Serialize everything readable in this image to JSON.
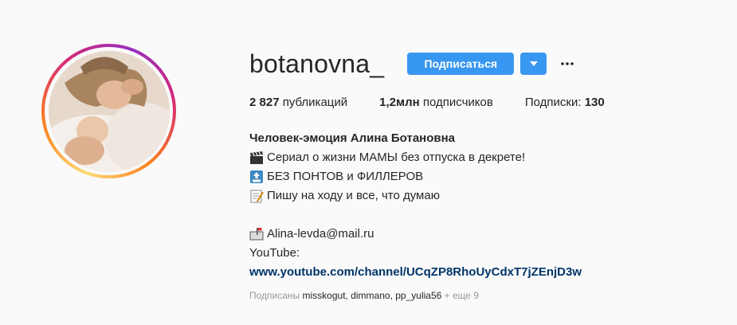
{
  "profile": {
    "username": "botanovna_",
    "follow_label": "Подписаться",
    "posts_count": "2 827",
    "posts_label": "публикаций",
    "followers_count": "1,2млн",
    "followers_label": "подписчиков",
    "following_label": "Подписки:",
    "following_count": "130"
  },
  "bio": {
    "name": "Человек-эмоция Алина Ботановна",
    "line1": "Сериал о жизни МАМЫ без отпуска в декрете!",
    "line2": "БЕЗ ПОНТОВ и ФИЛЛЕРОВ",
    "line3": "Пишу на ходу и все, что думаю",
    "email": "Alina-levda@mail.ru",
    "youtube_label": "YouTube:",
    "link": "www.youtube.com/channel/UCqZP8RhoUyCdxT7jZEnjD3w"
  },
  "followed_by": {
    "prefix": "Подписаны",
    "user1": "misskogut,",
    "user2": "dimmano,",
    "user3": "pp_yulia56",
    "suffix": "+ еще 9"
  },
  "icons": {
    "emoji1": "clapper-board-icon",
    "emoji2": "top-arrow-icon",
    "emoji3": "memo-icon",
    "emoji4": "mailbox-icon"
  },
  "colors": {
    "accent": "#3897f0",
    "link": "#003569",
    "text": "#262626",
    "muted": "#999999"
  }
}
